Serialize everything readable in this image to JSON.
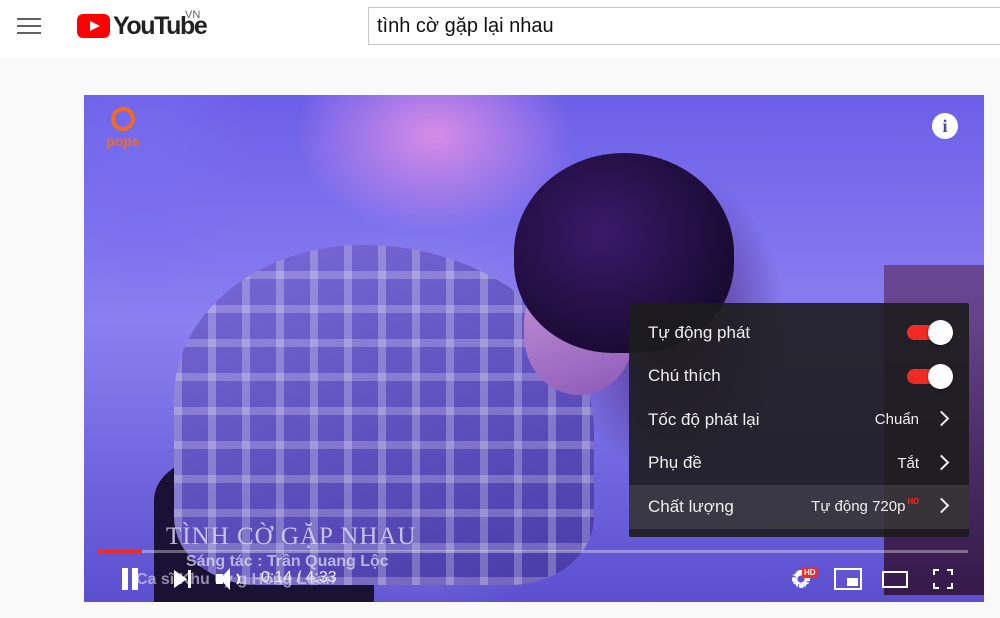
{
  "header": {
    "menu_icon": "hamburger-menu-icon",
    "logo_text": "YouTube",
    "logo_country": "VN",
    "search_value": "tình cờ gặp lại nhau"
  },
  "player": {
    "channel_logo_text": "pops",
    "info_icon_glyph": "i",
    "video_title_overlay": "TÌNH CỜ GẶP NHAU",
    "composer_overlay": "Sáng tác :  Trần Quang Lộc",
    "singer_overlay": "Ca sĩ   Khu   uy    g Hồng Loan",
    "settings_menu": {
      "items": [
        {
          "label": "Tự động phát",
          "type": "toggle",
          "on": true
        },
        {
          "label": "Chú thích",
          "type": "toggle",
          "on": true
        },
        {
          "label": "Tốc độ phát lại",
          "value": "Chuẩn",
          "type": "submenu"
        },
        {
          "label": "Phụ đề",
          "value": "Tắt",
          "type": "submenu"
        },
        {
          "label": "Chất lượng",
          "value": "Tự động 720p",
          "value_badge": "HD",
          "type": "submenu",
          "active": true
        }
      ]
    },
    "controls": {
      "current_time": "0:14",
      "duration": "4:33",
      "time_display": "0:14 / 4:33",
      "progress_fraction": 0.051,
      "settings_badge": "HD"
    },
    "colors": {
      "accent_red": "#f12b24",
      "brand_orange": "#f26b21"
    }
  }
}
